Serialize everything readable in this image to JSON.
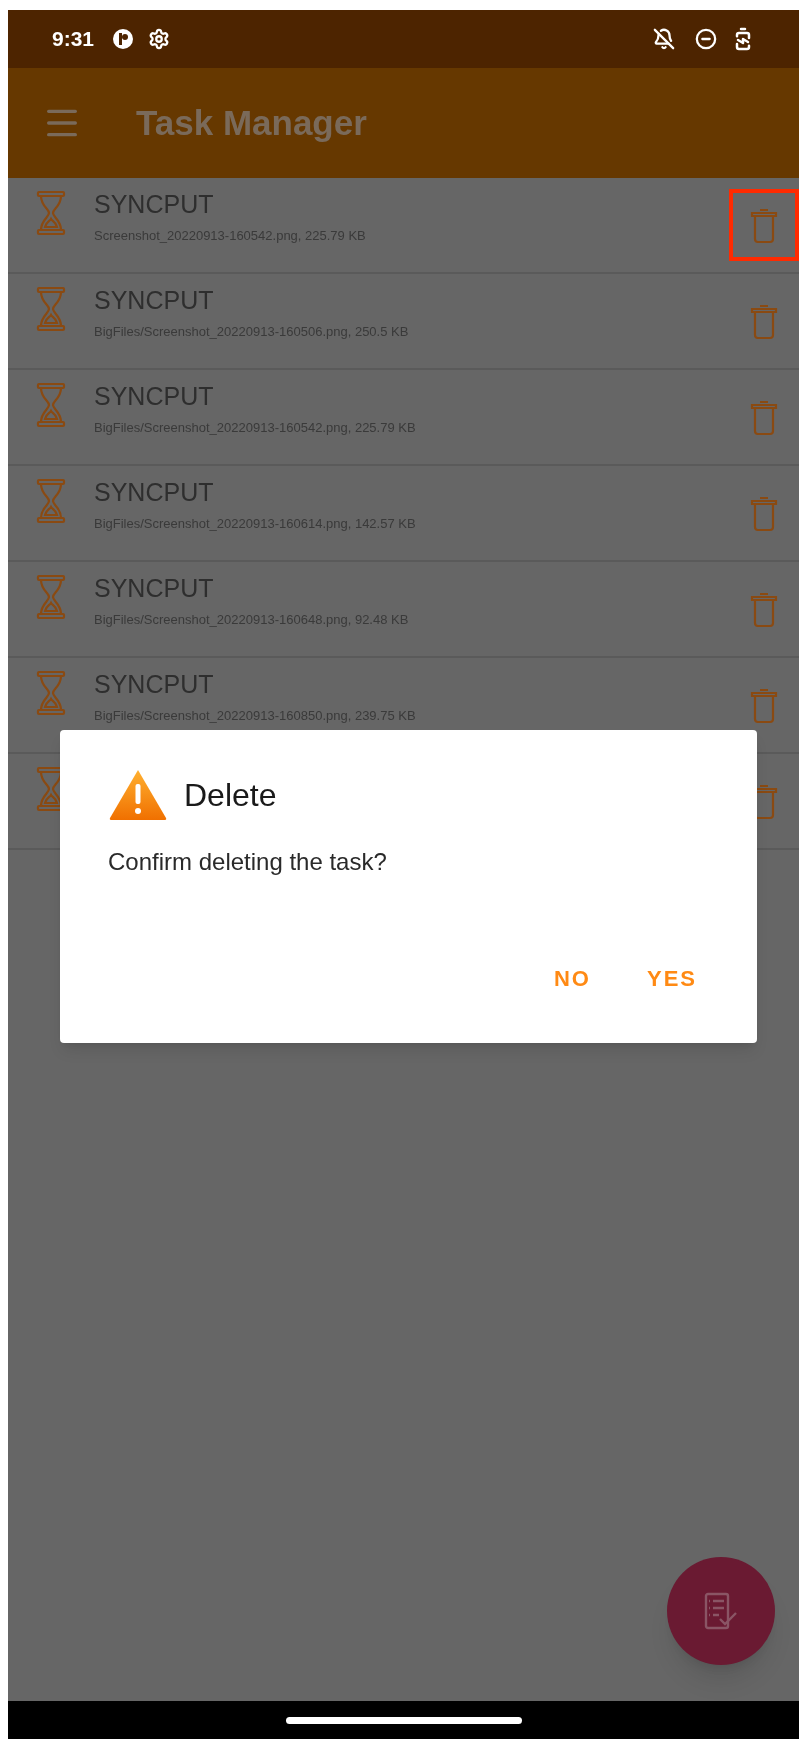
{
  "status_bar": {
    "time": "9:31"
  },
  "app_bar": {
    "title": "Task Manager"
  },
  "tasks": [
    {
      "title": "SYNCPUT",
      "detail": "Screenshot_20220913-160542.png, 225.79 KB",
      "highlighted": true
    },
    {
      "title": "SYNCPUT",
      "detail": "BigFiles/Screenshot_20220913-160506.png, 250.5 KB",
      "highlighted": false
    },
    {
      "title": "SYNCPUT",
      "detail": "BigFiles/Screenshot_20220913-160542.png, 225.79 KB",
      "highlighted": false
    },
    {
      "title": "SYNCPUT",
      "detail": "BigFiles/Screenshot_20220913-160614.png, 142.57 KB",
      "highlighted": false
    },
    {
      "title": "SYNCPUT",
      "detail": "BigFiles/Screenshot_20220913-160648.png, 92.48 KB",
      "highlighted": false
    },
    {
      "title": "SYNCPUT",
      "detail": "BigFiles/Screenshot_20220913-160850.png, 239.75 KB",
      "highlighted": false
    },
    {
      "highlighted": false
    }
  ],
  "dialog": {
    "title": "Delete",
    "message": "Confirm deleting the task?",
    "buttons": [
      "NO",
      "YES"
    ]
  }
}
